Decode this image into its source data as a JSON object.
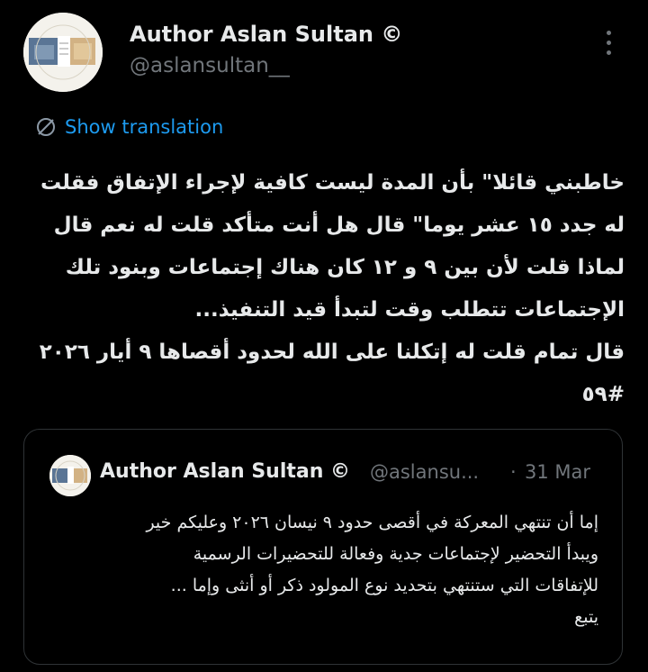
{
  "tweet": {
    "author": {
      "name": "Author Aslan Sultan ©",
      "handle": "@aslansultan__"
    },
    "translate_label": "Show translation",
    "body_lines": [
      "خاطبني قائلا\" بأن المدة ليست كافية لإجراء الإتفاق فقلت",
      "له جدد ١٥ عشر يوما\" قال هل أنت متأكد قلت له نعم قال",
      "لماذا قلت لأن بين ٩ و ١٢ كان هناك إجتماعات وبنود تلك",
      "الإجتماعات تتطلب وقت لتبدأ قيد التنفيذ...",
      "قال تمام قلت له إتكلنا على الله لحدود أقصاها ٩ أيار ٢٠٢٦",
      "#٥٩"
    ]
  },
  "quoted_tweet": {
    "name": "Author Aslan Sultan ©",
    "handle": "@aslansu...",
    "separator": "·",
    "date": "31 Mar",
    "body_lines": [
      "إما أن تنتهي المعركة في أقصى حدود ٩ نيسان ٢٠٢٦ وعليكم خير",
      "ويبدأ التحضير لإجتماعات جدية وفعالة للتحضيرات الرسمية",
      "للإتفاقات التي ستنتهي بتحديد نوع المولود ذكر أو أنثى وإما ...",
      "يتبع"
    ]
  },
  "colors": {
    "background": "#000000",
    "text_primary": "#e7e9ea",
    "text_secondary": "#71767b",
    "accent": "#1d9bf0",
    "border": "#2f3336"
  },
  "icons": {
    "more": "more-vertical-icon",
    "translate": "translate-globe-icon"
  }
}
